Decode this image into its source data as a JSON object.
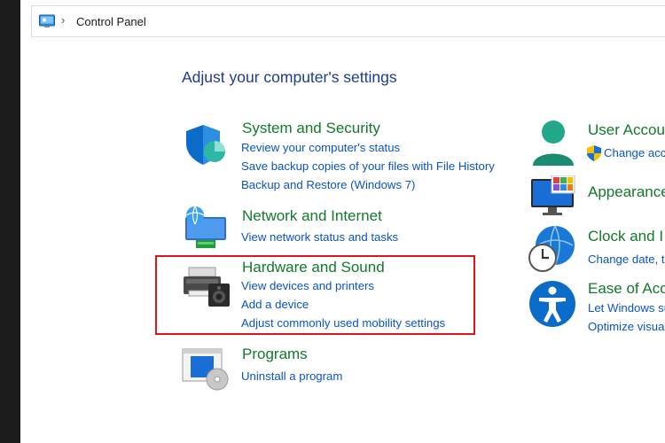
{
  "address_bar": {
    "icon": "control-panel-icon",
    "separator": "›",
    "location": "Control Panel"
  },
  "heading": "Adjust your computer's settings",
  "left_categories": [
    {
      "title": "System and Security",
      "icon": "shield-icon",
      "links": [
        "Review your computer's status",
        "Save backup copies of your files with File History",
        "Backup and Restore (Windows 7)"
      ]
    },
    {
      "title": "Network and Internet",
      "icon": "network-globe-icon",
      "links": [
        "View network status and tasks"
      ]
    },
    {
      "title": "Hardware and Sound",
      "icon": "printer-speaker-icon",
      "links": [
        "View devices and printers",
        "Add a device",
        "Adjust commonly used mobility settings"
      ],
      "highlighted": true
    },
    {
      "title": "Programs",
      "icon": "programs-disc-icon",
      "links": [
        "Uninstall a program"
      ]
    }
  ],
  "right_categories": [
    {
      "title": "User Accou",
      "icon": "user-accounts-icon",
      "links": [
        "Change acc"
      ],
      "link_icon": "uac-shield-icon"
    },
    {
      "title": "Appearance",
      "icon": "appearance-monitor-icon",
      "links": []
    },
    {
      "title": "Clock and I",
      "icon": "clock-globe-icon",
      "links": [
        "Change date, ti"
      ]
    },
    {
      "title": "Ease of Acc",
      "icon": "ease-of-access-icon",
      "links": [
        "Let Windows su",
        "Optimize visua"
      ]
    }
  ],
  "colors": {
    "heading": "#1e3c8c",
    "category_title": "#127a2a",
    "link": "#0a54c8",
    "highlight_border": "#e1141e"
  }
}
